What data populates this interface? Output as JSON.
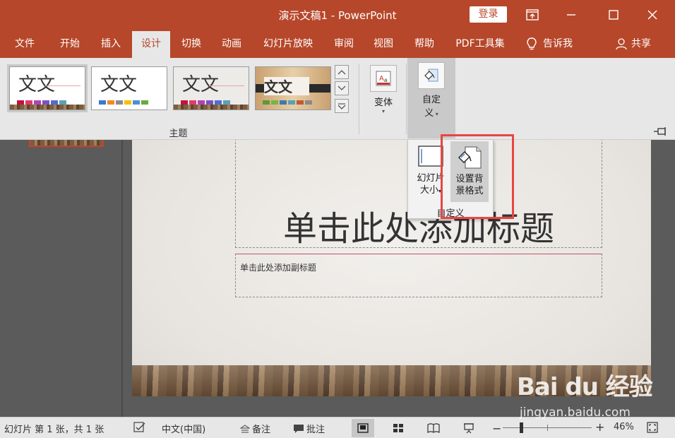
{
  "window": {
    "title": "演示文稿1  -  PowerPoint",
    "login_label": "登录"
  },
  "menu": {
    "items": [
      "文件",
      "开始",
      "插入",
      "设计",
      "切换",
      "动画",
      "幻灯片放映",
      "审阅",
      "视图",
      "帮助",
      "PDF工具集"
    ],
    "active": "设计",
    "tell_me": "告诉我",
    "share": "共享"
  },
  "ribbon": {
    "themes": [
      {
        "label": "文文",
        "colors": [
          "#c0143c",
          "#e23a6e",
          "#b043b8",
          "#7b52c0",
          "#4d6ed0",
          "#5aa0b8"
        ]
      },
      {
        "label": "文文",
        "colors": [
          "#3a78d2",
          "#f08a24",
          "#8c8c8c",
          "#f5c000",
          "#4a8fd8",
          "#6aaa3a"
        ]
      },
      {
        "label": "文文",
        "colors": [
          "#c0143c",
          "#e23a6e",
          "#b043b8",
          "#7b52c0",
          "#4d6ed0",
          "#5aa0b8"
        ]
      },
      {
        "label": "文文",
        "colors": [
          "#5a9a3a",
          "#7ab24a",
          "#3c7ca8",
          "#5aa0b8",
          "#c05a3a",
          "#8a8a8a"
        ]
      }
    ],
    "themes_group_label": "主题",
    "variants_label": "变体",
    "custom_label_line1": "自定",
    "custom_label_line2": "义"
  },
  "dropdown": {
    "slide_size_line1": "幻灯片",
    "slide_size_line2": "大小",
    "bg_format_line1": "设置背",
    "bg_format_line2": "景格式",
    "group_label": "自定义"
  },
  "slide": {
    "title": "单击此处添加标题",
    "subtitle": "单击此处添加副标题"
  },
  "status": {
    "slide_info": "幻灯片 第 1 张，共 1 张",
    "language": "中文(中国)",
    "notes": "备注",
    "comments": "批注",
    "zoom": "46%"
  },
  "watermark": {
    "brand": "Bai du 经验",
    "url": "jingyan.baidu.com"
  },
  "colors": {
    "accent": "#b7472a",
    "highlight": "#e84545"
  }
}
